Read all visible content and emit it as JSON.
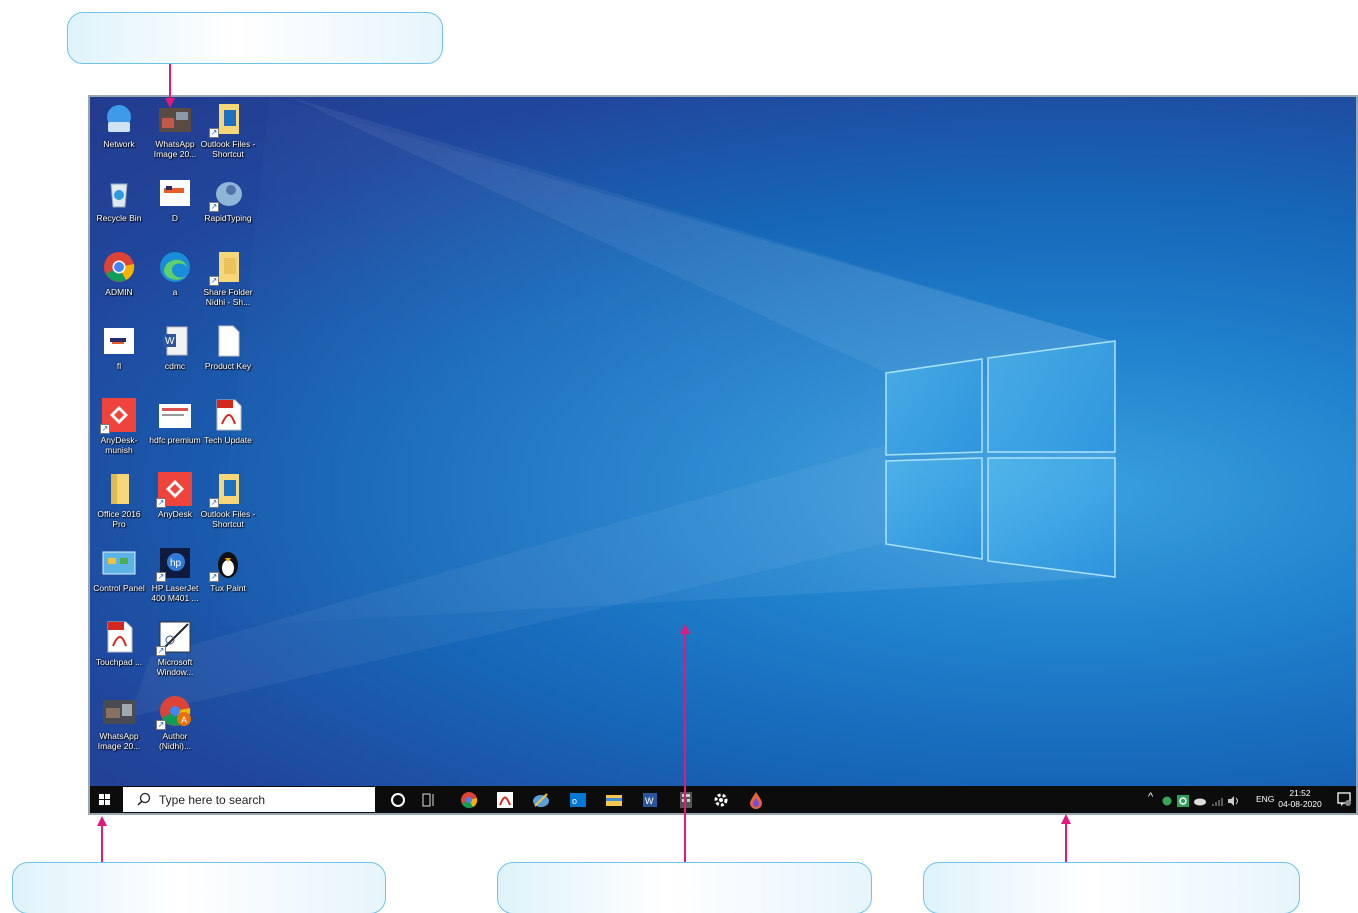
{
  "callouts": {
    "top": "",
    "bottom_left": "",
    "bottom_center": "",
    "bottom_right": ""
  },
  "desktop": {
    "icons": [
      {
        "label": "Network",
        "icon": "network-icon"
      },
      {
        "label": "WhatsApp Image 20...",
        "icon": "photo-icon"
      },
      {
        "label": "Outlook Files - Shortcut",
        "icon": "folder-shortcut-icon"
      },
      {
        "label": "Recycle Bin",
        "icon": "recycle-bin-icon"
      },
      {
        "label": "D",
        "icon": "document-image-icon"
      },
      {
        "label": "RapidTyping",
        "icon": "rapidtyping-icon"
      },
      {
        "label": "ADMIN",
        "icon": "chrome-icon"
      },
      {
        "label": "a",
        "icon": "edge-icon"
      },
      {
        "label": "Share Folder Nidhi - Sh...",
        "icon": "folder-shortcut-icon"
      },
      {
        "label": "fl",
        "icon": "document-image-icon"
      },
      {
        "label": "cdmc",
        "icon": "word-doc-icon"
      },
      {
        "label": "Product Key",
        "icon": "text-file-icon"
      },
      {
        "label": "AnyDesk-munish",
        "icon": "anydesk-icon"
      },
      {
        "label": "hdfc premium",
        "icon": "document-image-icon"
      },
      {
        "label": "Tech Update",
        "icon": "pdf-icon"
      },
      {
        "label": "Office 2016 Pro",
        "icon": "folder-icon"
      },
      {
        "label": "AnyDesk",
        "icon": "anydesk-icon"
      },
      {
        "label": "Outlook Files - Shortcut",
        "icon": "folder-shortcut-icon"
      },
      {
        "label": "Control Panel",
        "icon": "control-panel-icon"
      },
      {
        "label": "HP LaserJet 400 M401 ...",
        "icon": "hp-printer-icon"
      },
      {
        "label": "Tux Paint",
        "icon": "tux-paint-icon"
      },
      {
        "label": "Touchpad ...",
        "icon": "pdf-icon"
      },
      {
        "label": "Microsoft Window...",
        "icon": "window-app-icon"
      },
      {
        "label": "WhatsApp Image 20...",
        "icon": "photo-icon"
      },
      {
        "label": "Author (Nidhi)...",
        "icon": "chrome-profile-icon"
      }
    ]
  },
  "taskbar": {
    "search_placeholder": "Type here to search",
    "pinned": [
      "cortana-icon",
      "task-view-icon",
      "chrome-icon",
      "acrobat-icon",
      "paint-icon",
      "outlook-icon",
      "file-explorer-icon",
      "word-icon",
      "calculator-icon",
      "settings-icon",
      "dropper-icon"
    ],
    "language": "ENG",
    "time": "21:52",
    "date": "04-08-2020",
    "tray_chevron": "^"
  },
  "colors": {
    "taskbar_bg": "#0c0c0c",
    "arrow": "#e0197d",
    "callout_border": "#6fc3e8",
    "wallpaper_blue": "#1f80cc"
  }
}
